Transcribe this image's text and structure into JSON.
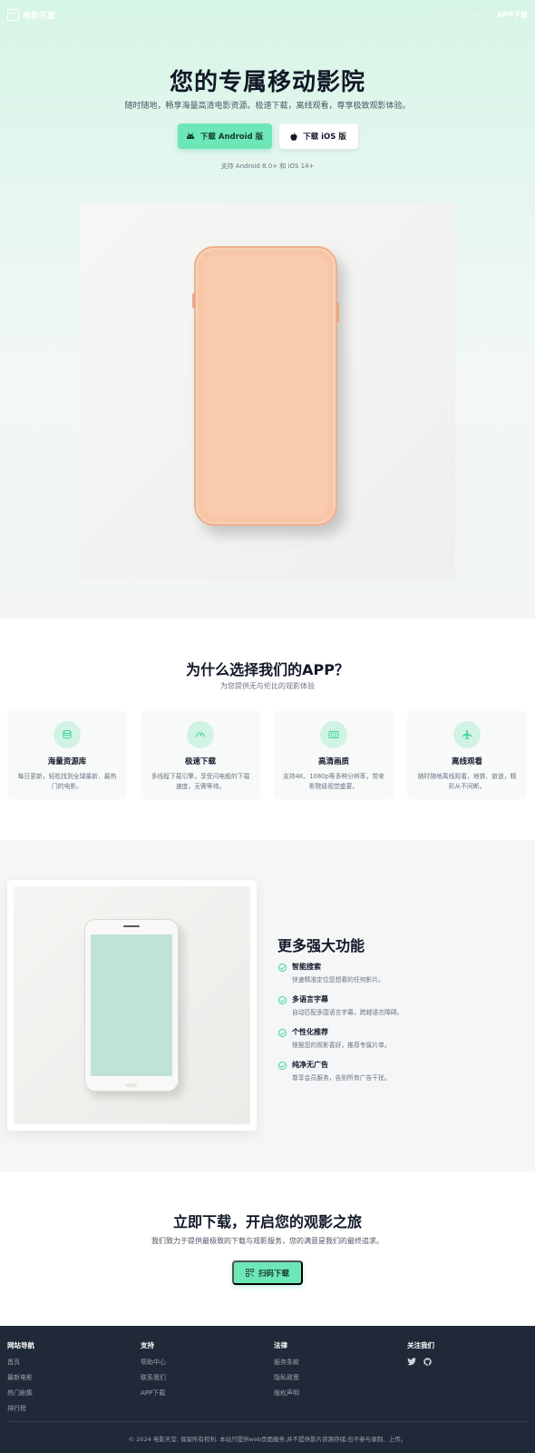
{
  "header": {
    "brand": "电影天堂",
    "nav": [
      "首页",
      "电影",
      "APP下载"
    ]
  },
  "hero": {
    "title": "您的专属移动影院",
    "subtitle": "随时随地，畅享海量高清电影资源。极速下载，离线观看，尊享极致观影体验。",
    "android_button": "下载 Android 版",
    "ios_button": "下载 iOS 版",
    "note": "支持 Android 8.0+ 和 iOS 14+"
  },
  "why": {
    "title": "为什么选择我们的APP？",
    "subtitle": "为您提供无与伦比的观影体验",
    "cards": [
      {
        "icon": "database-icon",
        "title": "海量资源库",
        "desc": "每日更新，轻松找到全球最新、最热门的电影。"
      },
      {
        "icon": "speedometer-icon",
        "title": "极速下载",
        "desc": "多线程下载引擎，享受闪电般的下载速度，无需等待。"
      },
      {
        "icon": "hd-icon",
        "title": "高清画质",
        "desc": "支持4K、1080p等多种分辨率，带来影院级视觉盛宴。"
      },
      {
        "icon": "airplane-icon",
        "title": "离线观看",
        "desc": "随时随地离线观看，地铁、旅途，精彩从不间断。"
      }
    ]
  },
  "features": {
    "title": "更多强大功能",
    "items": [
      {
        "title": "智能搜索",
        "desc": "快速精准定位您想看的任何影片。"
      },
      {
        "title": "多语言字幕",
        "desc": "自动匹配多国语言字幕，跨越语言障碍。"
      },
      {
        "title": "个性化推荐",
        "desc": "根据您的观影喜好，推荐专属片单。"
      },
      {
        "title": "纯净无广告",
        "desc": "尊享会员服务，告别所有广告干扰。"
      }
    ]
  },
  "cta": {
    "title": "立即下载，开启您的观影之旅",
    "subtitle": "我们致力于提供最极致的下载与观影服务，您的满意是我们的最终追求。",
    "button": "扫码下载"
  },
  "footer": {
    "columns": [
      {
        "title": "网站导航",
        "links": [
          "首页",
          "最新电影",
          "热门剧集",
          "排行榜"
        ]
      },
      {
        "title": "支持",
        "links": [
          "帮助中心",
          "联系我们",
          "APP下载"
        ]
      },
      {
        "title": "法律",
        "links": [
          "服务条款",
          "隐私政策",
          "版权声明"
        ]
      },
      {
        "title": "关注我们",
        "links": []
      }
    ],
    "social": [
      "twitter-icon",
      "github-icon"
    ],
    "copyright": "© 2024 电影天堂. 保留所有权利. 本站只提供web页面服务,并不提供影片资源存储,也不参与录制、上传。"
  },
  "colors": {
    "accent": "#6ee7b7",
    "accent_light": "#d1f3e3",
    "footer_bg": "#1f2937"
  }
}
